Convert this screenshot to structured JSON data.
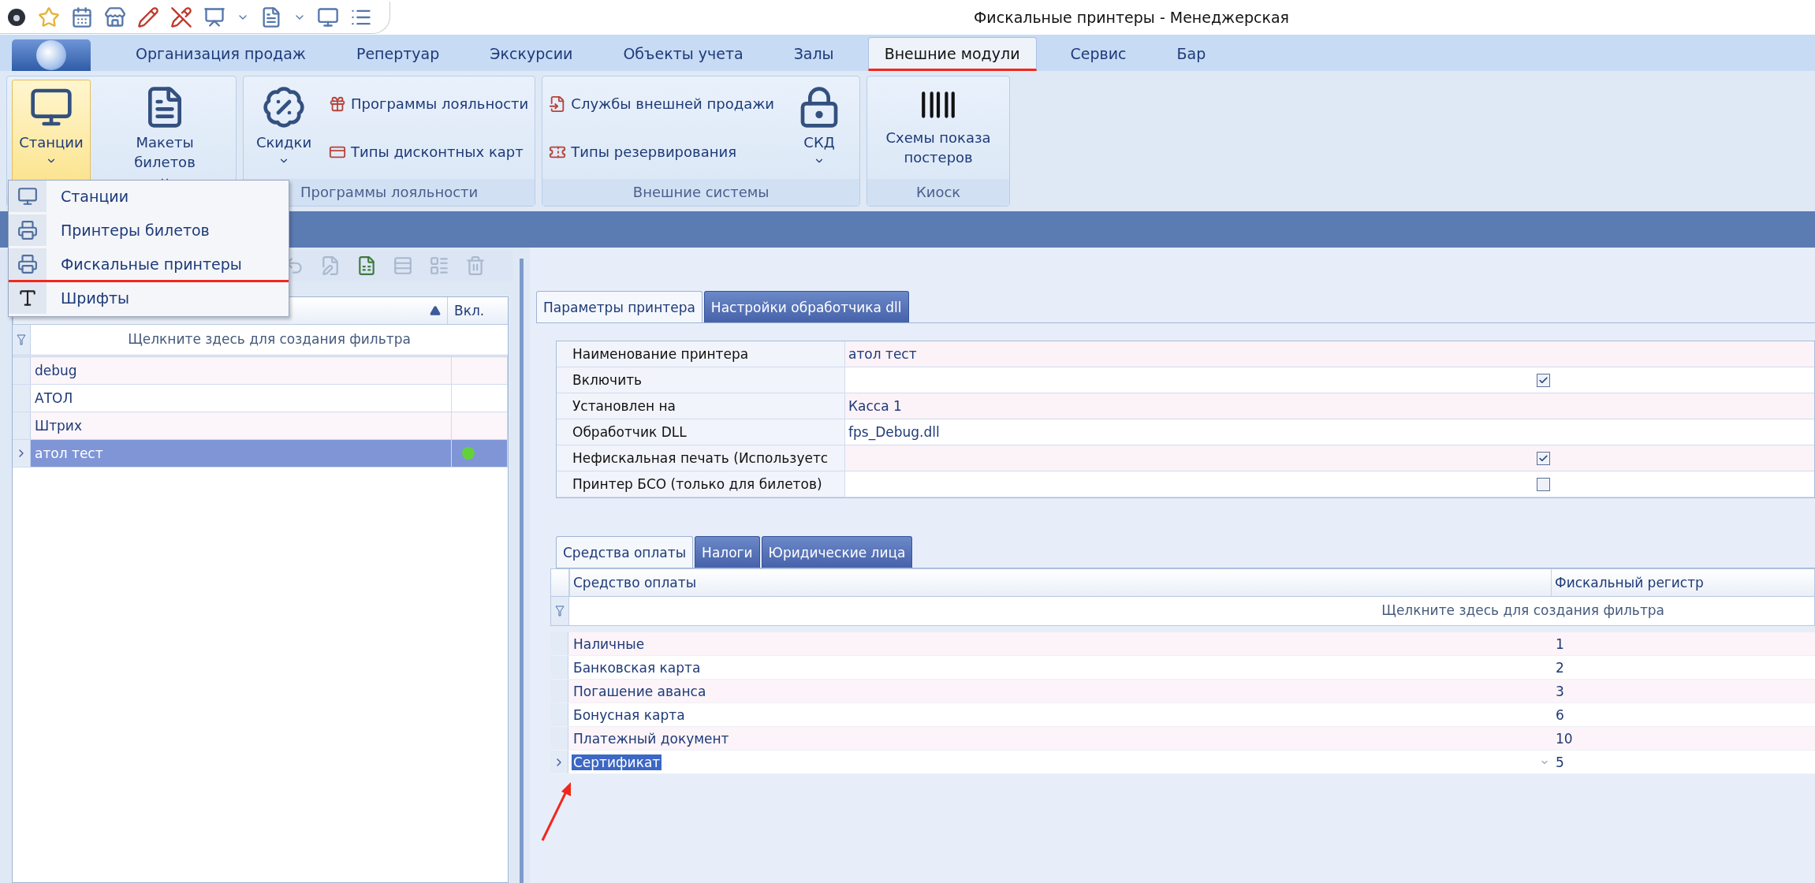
{
  "window": {
    "title": "Фискальные принтеры - Менеджерская"
  },
  "ribbon": {
    "tabs": [
      {
        "label": "Организация продаж",
        "selected": false,
        "underlined": false
      },
      {
        "label": "Репертуар",
        "selected": false,
        "underlined": false
      },
      {
        "label": "Экскурсии",
        "selected": false,
        "underlined": false
      },
      {
        "label": "Объекты учета",
        "selected": false,
        "underlined": false
      },
      {
        "label": "Залы",
        "selected": false,
        "underlined": false
      },
      {
        "label": "Внешние модули",
        "selected": true,
        "underlined": true
      },
      {
        "label": "Сервис",
        "selected": false,
        "underlined": false
      },
      {
        "label": "Бар",
        "selected": false,
        "underlined": false
      }
    ],
    "groups": [
      {
        "items": [
          {
            "kind": "large",
            "label": "Станции",
            "dropdown": true,
            "pressed": true
          },
          {
            "kind": "large",
            "label": "Макеты билетов",
            "dropdown": true,
            "pressed": false
          }
        ]
      },
      {
        "label": "Программы лояльности",
        "items": [
          {
            "kind": "large",
            "label": "Скидки",
            "dropdown": true,
            "pressed": false
          },
          {
            "kind": "small",
            "label": "Программы лояльности"
          },
          {
            "kind": "small",
            "label": "Типы дисконтных карт"
          }
        ]
      },
      {
        "label": "Внешние системы",
        "items": [
          {
            "kind": "small",
            "label": "Службы внешней продажи"
          },
          {
            "kind": "small",
            "label": "Типы резервирования"
          },
          {
            "kind": "large",
            "label": "СКД",
            "dropdown": true,
            "pressed": false
          }
        ]
      },
      {
        "label": "Киоск",
        "items": [
          {
            "kind": "large",
            "label": "Схемы показа постеров",
            "dropdown": false,
            "pressed": false
          }
        ]
      }
    ]
  },
  "menu": {
    "items": [
      {
        "label": "Станции",
        "underlined": false
      },
      {
        "label": "Принтеры билетов",
        "underlined": false
      },
      {
        "label": "Фискальные принтеры",
        "underlined": true
      },
      {
        "label": "Шрифты",
        "underlined": false
      }
    ]
  },
  "printers": {
    "sorted": true,
    "columns": [
      "Вкл."
    ],
    "filter_hint": "Щелкните здесь для создания фильтра",
    "rows": [
      {
        "name": "debug",
        "enabled": false,
        "selected": false
      },
      {
        "name": "АТОЛ",
        "enabled": false,
        "selected": false
      },
      {
        "name": "Штрих",
        "enabled": false,
        "selected": false
      },
      {
        "name": "атол тест",
        "enabled": true,
        "selected": true
      }
    ]
  },
  "detail_tabs": [
    {
      "label": "Параметры принтера",
      "selected": true
    },
    {
      "label": "Настройки обработчика dll",
      "selected": false
    }
  ],
  "properties": [
    {
      "kind": "text",
      "label": "Наименование принтера",
      "value": "атол тест"
    },
    {
      "kind": "check",
      "label": "Включить",
      "checked": true
    },
    {
      "kind": "text",
      "label": "Установлен на",
      "value": "Касса 1"
    },
    {
      "kind": "text",
      "label": "Обработчик DLL",
      "value": "fps_Debug.dll"
    },
    {
      "kind": "check",
      "label": "Нефискальная печать (Используетс",
      "checked": true
    },
    {
      "kind": "check",
      "label": "Принтер БСО (только для билетов)",
      "checked": false
    }
  ],
  "sub_tabs": [
    {
      "label": "Средства оплаты",
      "selected": true
    },
    {
      "label": "Налоги",
      "selected": false
    },
    {
      "label": "Юридические лица",
      "selected": false
    }
  ],
  "payments": {
    "columns": [
      "Средство оплаты",
      "Фискальный регистр"
    ],
    "filter_hint": "Щелкните здесь для создания фильтра",
    "pointer_arrow": true,
    "rows": [
      {
        "name": "Наличные",
        "register": "1",
        "selected": false
      },
      {
        "name": "Банковская карта",
        "register": "2",
        "selected": false
      },
      {
        "name": "Погашение аванса",
        "register": "3",
        "selected": false
      },
      {
        "name": "Бонусная карта",
        "register": "6",
        "selected": false
      },
      {
        "name": "Платежный документ",
        "register": "10",
        "selected": false
      },
      {
        "name": "Сертификат",
        "register": "5",
        "selected": true
      }
    ]
  }
}
